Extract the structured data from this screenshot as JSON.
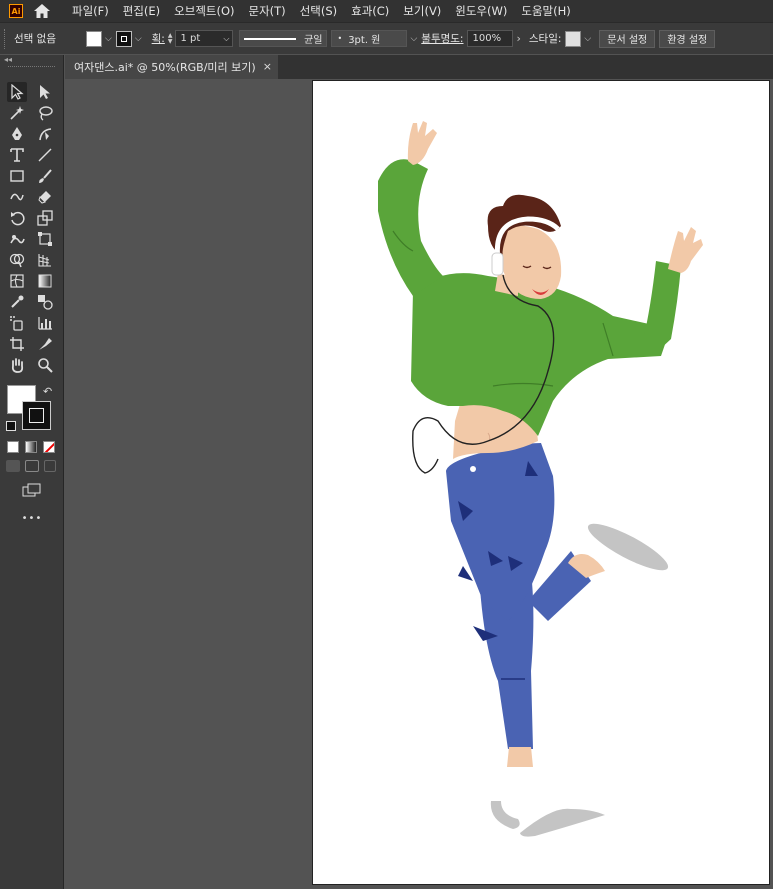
{
  "app": {
    "logo": "Ai",
    "home_icon": "home-icon"
  },
  "menu": [
    "파일(F)",
    "편집(E)",
    "오브젝트(O)",
    "문자(T)",
    "선택(S)",
    "효과(C)",
    "보기(V)",
    "윈도우(W)",
    "도움말(H)"
  ],
  "control": {
    "selection_label": "선택 없음",
    "fill_color": "#ffffff",
    "stroke_color": "#111111",
    "stroke_label": "획:",
    "stroke_weight": "1 pt",
    "profile_label": "균일",
    "brush_label": "3pt. 원",
    "opacity_label": "불투명도:",
    "opacity_value": "100%",
    "style_label": "스타일:",
    "doc_setup_button": "문서 설정",
    "preferences_button": "환경 설정"
  },
  "document_tab": {
    "title": "여자댄스.ai* @ 50%(RGB/미리 보기)",
    "close": "×"
  },
  "toolbar": {
    "collapse": "◂◂",
    "more": "•••",
    "tools": [
      "selection-tool",
      "direct-selection-tool",
      "magic-wand-tool",
      "lasso-tool",
      "pen-tool",
      "curvature-tool",
      "type-tool",
      "line-segment-tool",
      "rectangle-tool",
      "paintbrush-tool",
      "shaper-tool",
      "eraser-tool",
      "rotate-tool",
      "scale-tool",
      "warp-tool",
      "free-transform-tool",
      "shape-builder-tool",
      "perspective-grid-tool",
      "mesh-tool",
      "gradient-tool",
      "eyedropper-tool",
      "blend-tool",
      "symbol-sprayer-tool",
      "column-graph-tool",
      "artboard-tool",
      "slice-tool",
      "hand-tool",
      "zoom-tool"
    ]
  },
  "colors": {
    "sweater": "#5aa53a",
    "sweater_shadow": "#3f7e27",
    "jeans": "#4a63b3",
    "jeans_dark": "#1e2f7a",
    "skin": "#f2c9a8",
    "hair": "#5a2418",
    "shadow": "#c4c4c4"
  }
}
